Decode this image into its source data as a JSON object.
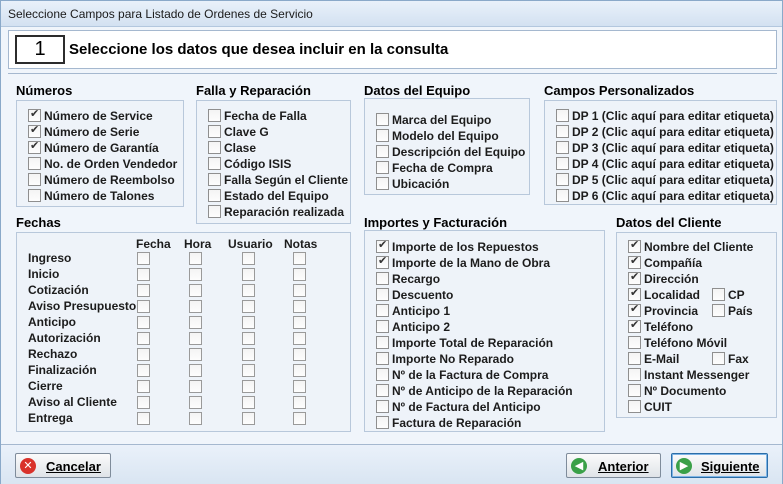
{
  "window": {
    "title": "Seleccione Campos para Listado de Ordenes de Servicio"
  },
  "header": {
    "step": "1",
    "text": "Seleccione los datos que desea incluir en la consulta"
  },
  "numeros": {
    "title": "Números",
    "items": [
      {
        "label": "Número de Service",
        "checked": true
      },
      {
        "label": "Número de Serie",
        "checked": true
      },
      {
        "label": "Número de Garantía",
        "checked": true
      },
      {
        "label": "No. de Orden Vendedor",
        "checked": false
      },
      {
        "label": "Número de Reembolso",
        "checked": false
      },
      {
        "label": "Número de Talones",
        "checked": false
      }
    ]
  },
  "falla": {
    "title": "Falla y Reparación",
    "items": [
      {
        "label": "Fecha de Falla",
        "checked": false
      },
      {
        "label": "Clave G",
        "checked": false
      },
      {
        "label": "Clase",
        "checked": false
      },
      {
        "label": "Código ISIS",
        "checked": false
      },
      {
        "label": "Falla Según el Cliente",
        "checked": false
      },
      {
        "label": "Estado del Equipo",
        "checked": false
      },
      {
        "label": "Reparación realizada",
        "checked": false
      }
    ]
  },
  "equipo": {
    "title": "Datos del Equipo",
    "items": [
      {
        "label": "Marca del Equipo",
        "checked": false
      },
      {
        "label": "Modelo del Equipo",
        "checked": false
      },
      {
        "label": "Descripción del Equipo",
        "checked": false
      },
      {
        "label": "Fecha de Compra",
        "checked": false
      },
      {
        "label": "Ubicación",
        "checked": false
      }
    ]
  },
  "personalizados": {
    "title": "Campos Personalizados",
    "items": [
      {
        "label": "DP 1 (Clic aquí para editar etiqueta)",
        "checked": false
      },
      {
        "label": "DP 2 (Clic aquí para editar etiqueta)",
        "checked": false
      },
      {
        "label": "DP 3 (Clic aquí para editar etiqueta)",
        "checked": false
      },
      {
        "label": "DP 4 (Clic aquí para editar etiqueta)",
        "checked": false
      },
      {
        "label": "DP 5 (Clic aquí para editar etiqueta)",
        "checked": false
      },
      {
        "label": "DP 6 (Clic aquí para editar etiqueta)",
        "checked": false
      }
    ]
  },
  "fechas": {
    "title": "Fechas",
    "columns": [
      "Fecha",
      "Hora",
      "Usuario",
      "Notas"
    ],
    "rows": [
      "Ingreso",
      "Inicio",
      "Cotización",
      "Aviso Presupuesto",
      "Anticipo",
      "Autorización",
      "Rechazo",
      "Finalización",
      "Cierre",
      "Aviso al Cliente",
      "Entrega"
    ]
  },
  "importes": {
    "title": "Importes y Facturación",
    "items": [
      {
        "label": "Importe de los Repuestos",
        "checked": true
      },
      {
        "label": "Importe de la Mano de Obra",
        "checked": true
      },
      {
        "label": "Recargo",
        "checked": false
      },
      {
        "label": "Descuento",
        "checked": false
      },
      {
        "label": "Anticipo 1",
        "checked": false
      },
      {
        "label": "Anticipo 2",
        "checked": false
      },
      {
        "label": "Importe Total de Reparación",
        "checked": false
      },
      {
        "label": "Importe No Reparado",
        "checked": false
      },
      {
        "label": "Nº de la Factura de Compra",
        "checked": false
      },
      {
        "label": "Nº de Anticipo de la Reparación",
        "checked": false
      },
      {
        "label": "Nº de Factura del Anticipo",
        "checked": false
      },
      {
        "label": "Factura de Reparación",
        "checked": false
      }
    ]
  },
  "cliente": {
    "title": "Datos del Cliente",
    "items": [
      {
        "label": "Nombre del Cliente",
        "checked": true
      },
      {
        "label": "Compañía",
        "checked": true
      },
      {
        "label": "Dirección",
        "checked": true
      },
      {
        "label": "Localidad",
        "checked": true
      },
      {
        "label": "Provincia",
        "checked": true
      },
      {
        "label": "Teléfono",
        "checked": true
      },
      {
        "label": "Teléfono Móvil",
        "checked": false
      },
      {
        "label": "E-Mail",
        "checked": false
      },
      {
        "label": "Instant Messenger",
        "checked": false
      },
      {
        "label": "Nº Documento",
        "checked": false
      },
      {
        "label": "CUIT",
        "checked": false
      }
    ],
    "extra": [
      {
        "label": "CP",
        "checked": false
      },
      {
        "label": "País",
        "checked": false
      },
      {
        "label": "Fax",
        "checked": false
      }
    ]
  },
  "buttons": {
    "cancel": "Cancelar",
    "prev": "Anterior",
    "next": "Siguiente"
  },
  "colors": {
    "cancel_icon": "#d9322b",
    "nav_icon": "#3aa048"
  }
}
